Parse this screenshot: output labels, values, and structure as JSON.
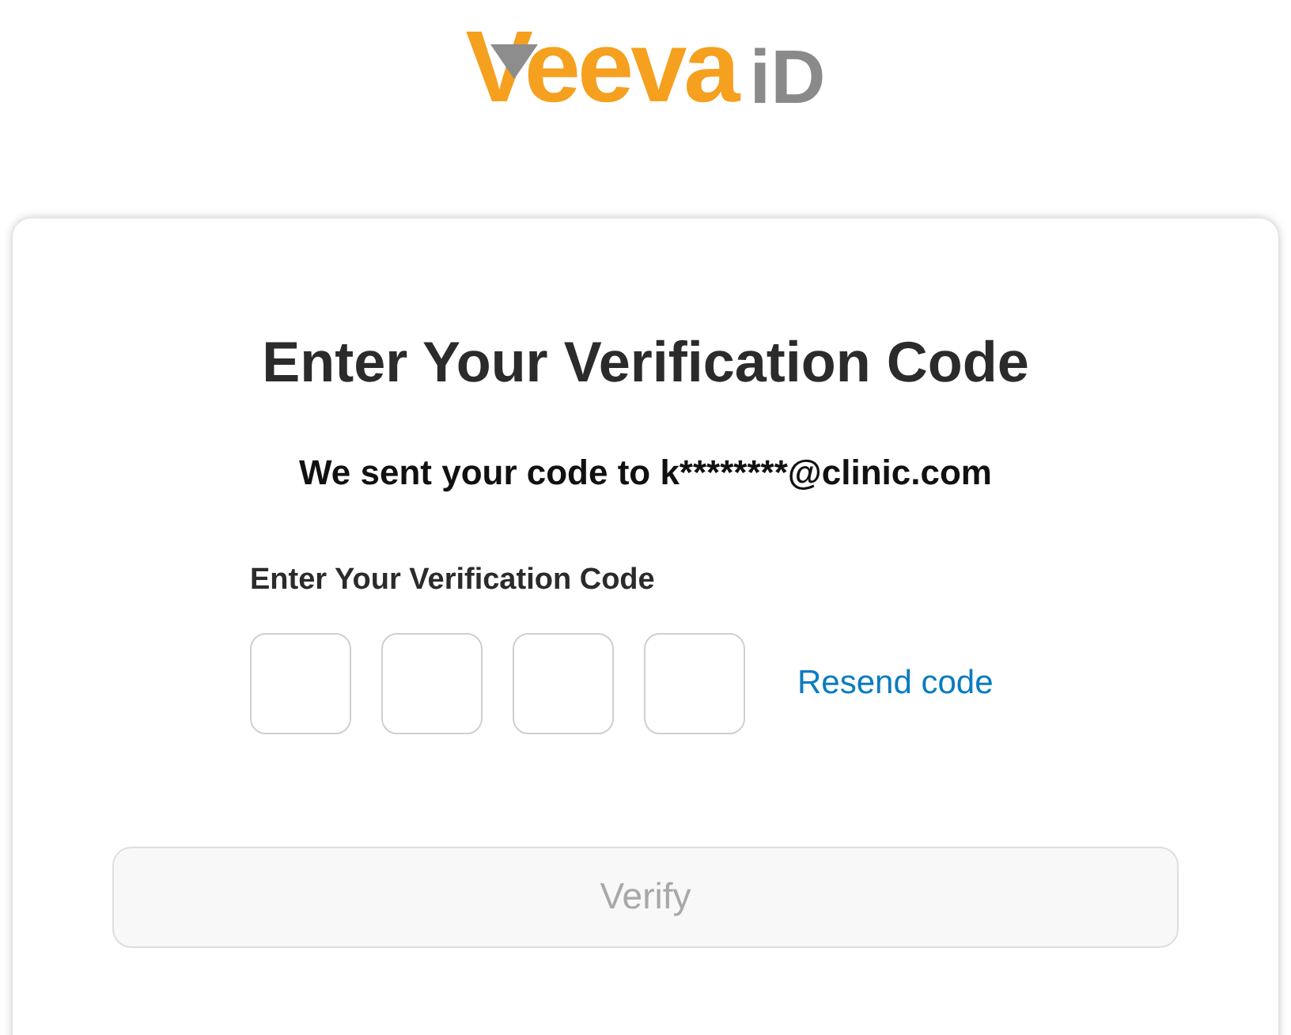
{
  "logo": {
    "brand": "Veeva",
    "suffix": "iD"
  },
  "card": {
    "title": "Enter Your Verification Code",
    "message": "We sent your code to k********@clinic.com",
    "code_label": "Enter Your Verification Code",
    "code_fields": [
      {
        "kind": "digit"
      },
      {
        "kind": "digit"
      },
      {
        "kind": "digit"
      },
      {
        "kind": "digit"
      }
    ],
    "resend_link": "Resend code",
    "verify_button": {
      "label": "Verify",
      "disabled": true
    }
  }
}
